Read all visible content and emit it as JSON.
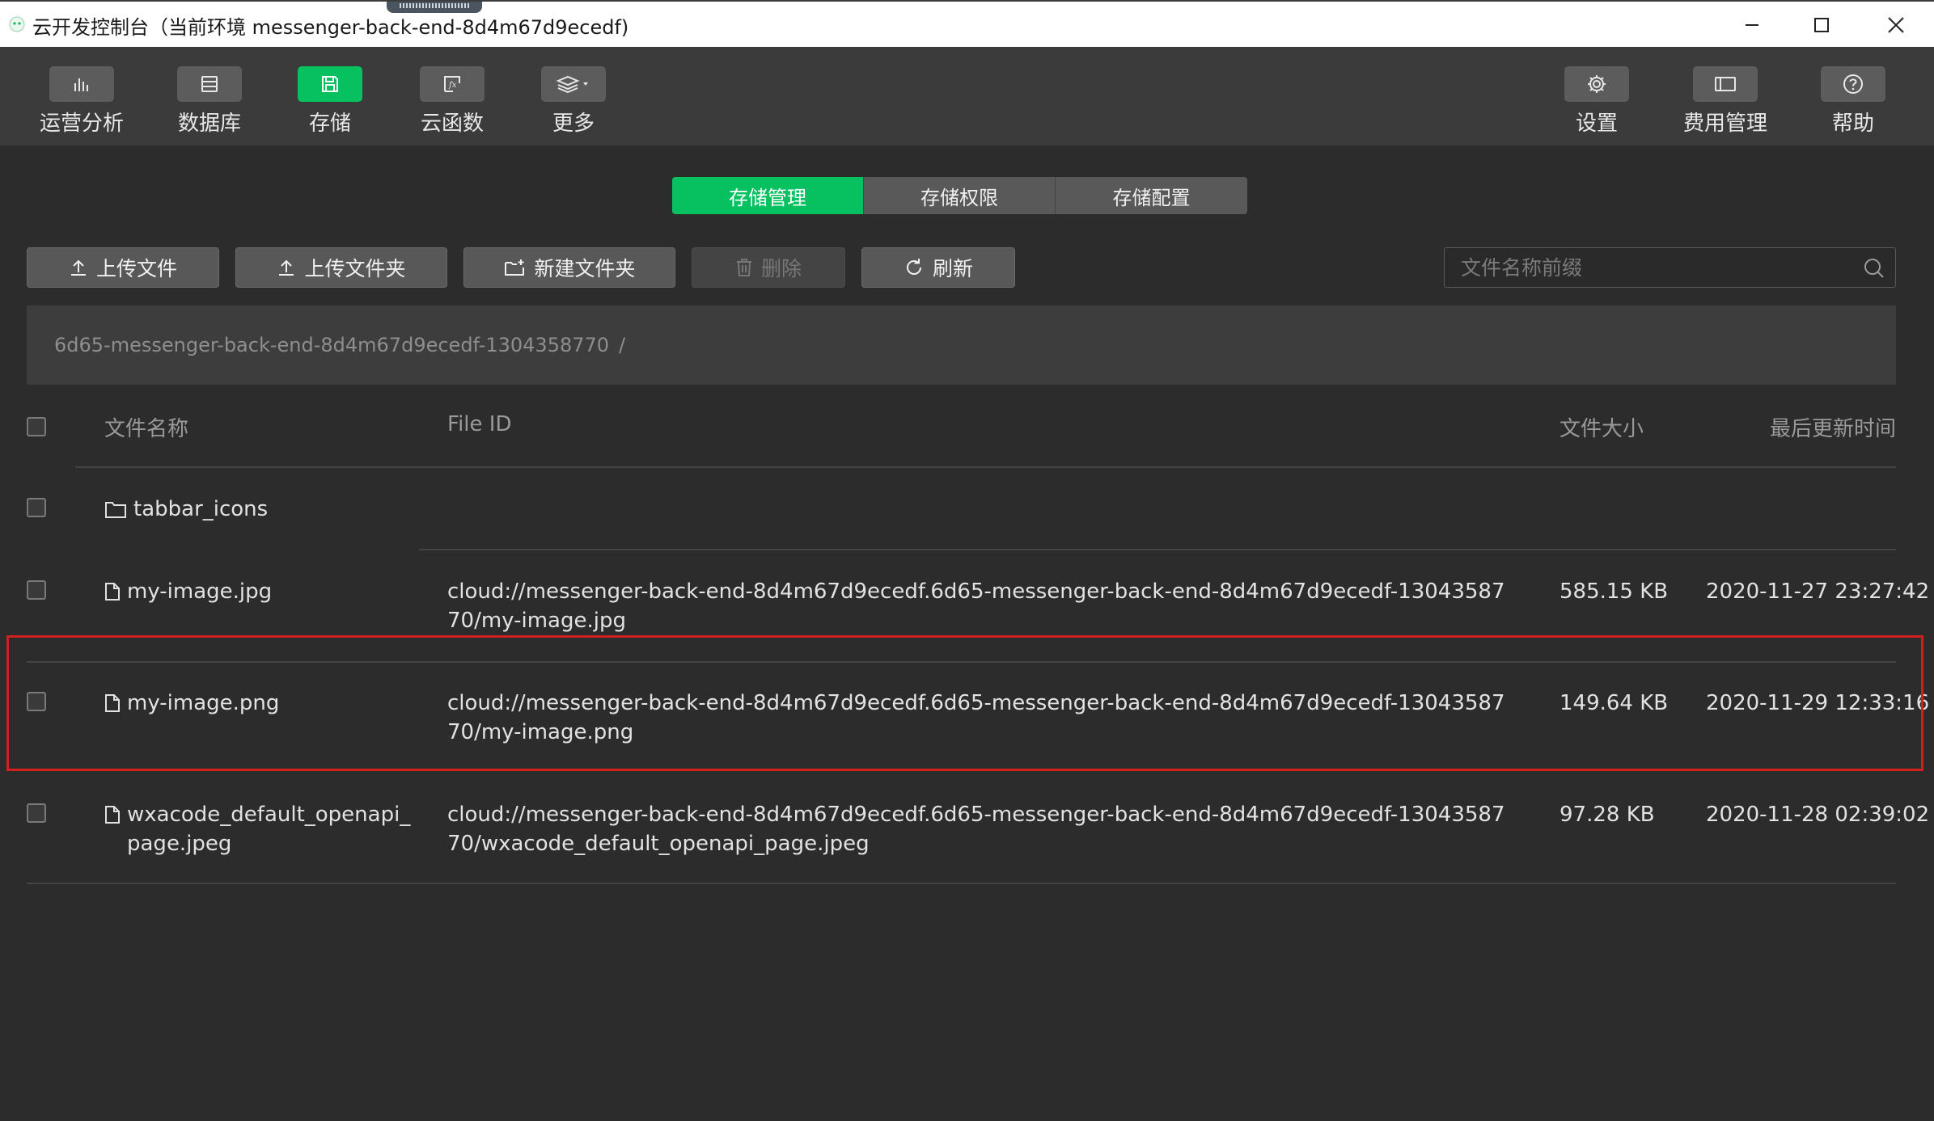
{
  "titlebar": {
    "title": "云开发控制台（当前环境 messenger-back-end-8d4m67d9ecedf)",
    "buttons": [
      "minimize-icon",
      "maximize-icon",
      "close-icon"
    ]
  },
  "toolbar": {
    "left": [
      {
        "label": "运营分析",
        "icon": "bar-chart-icon"
      },
      {
        "label": "数据库",
        "icon": "database-icon"
      },
      {
        "label": "存储",
        "icon": "storage-icon",
        "active": true
      },
      {
        "label": "云函数",
        "icon": "function-icon"
      },
      {
        "label": "更多",
        "icon": "layers-icon"
      }
    ],
    "right": [
      {
        "label": "设置",
        "icon": "gear-icon"
      },
      {
        "label": "费用管理",
        "icon": "billing-icon"
      },
      {
        "label": "帮助",
        "icon": "help-icon"
      }
    ]
  },
  "tabs": [
    {
      "label": "存储管理",
      "active": true
    },
    {
      "label": "存储权限"
    },
    {
      "label": "存储配置"
    }
  ],
  "actions": {
    "upload_file": "上传文件",
    "upload_folder": "上传文件夹",
    "new_folder": "新建文件夹",
    "delete": "删除",
    "refresh": "刷新"
  },
  "search": {
    "placeholder": "文件名称前缀",
    "value": ""
  },
  "breadcrumb": {
    "path": "6d65-messenger-back-end-8d4m67d9ecedf-1304358770",
    "separator": "/"
  },
  "table": {
    "columns": {
      "name": "文件名称",
      "file_id": "File ID",
      "size": "文件大小",
      "updated": "最后更新时间"
    },
    "rows": [
      {
        "type": "folder",
        "name": "tabbar_icons",
        "file_id": "",
        "size": "",
        "updated": ""
      },
      {
        "type": "file",
        "name": "my-image.jpg",
        "file_id": "cloud://messenger-back-end-8d4m67d9ecedf.6d65-messenger-back-end-8d4m67d9ecedf-1304358770/my-image.jpg",
        "size": "585.15 KB",
        "updated": "2020-11-27 23:27:42"
      },
      {
        "type": "file",
        "name": "my-image.png",
        "file_id": "cloud://messenger-back-end-8d4m67d9ecedf.6d65-messenger-back-end-8d4m67d9ecedf-1304358770/my-image.png",
        "size": "149.64 KB",
        "updated": "2020-11-29 12:33:16",
        "highlighted": true
      },
      {
        "type": "file",
        "name": "wxacode_default_openapi_page.jpeg",
        "file_id": "cloud://messenger-back-end-8d4m67d9ecedf.6d65-messenger-back-end-8d4m67d9ecedf-1304358770/wxacode_default_openapi_page.jpeg",
        "size": "97.28 KB",
        "updated": "2020-11-28 02:39:02"
      }
    ]
  },
  "colors": {
    "accent": "#07c160",
    "highlight_border": "#d22020",
    "background": "#2c2c2c",
    "toolbar": "#3b3b3b"
  }
}
